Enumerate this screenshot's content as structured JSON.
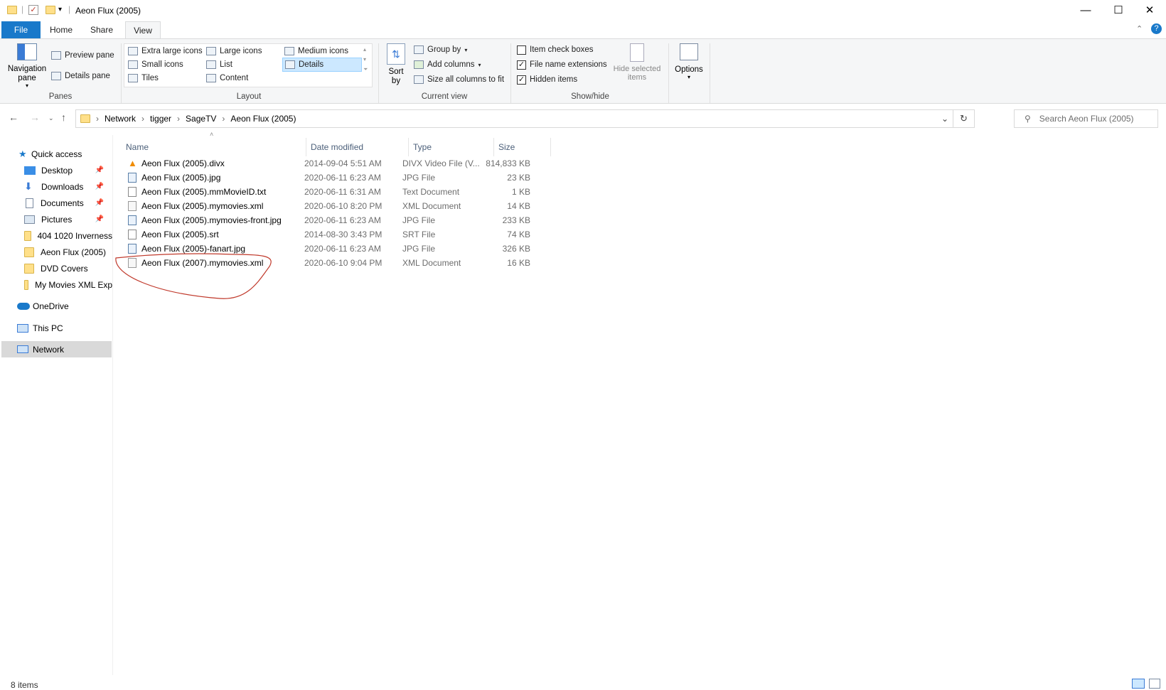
{
  "window": {
    "title": "Aeon Flux (2005)",
    "minimize": "—",
    "maximize": "☐",
    "close": "✕"
  },
  "ribbon_tabs": [
    "File",
    "Home",
    "Share",
    "View"
  ],
  "ribbon": {
    "panes": {
      "navigation_pane": "Navigation pane",
      "preview_pane": "Preview pane",
      "details_pane": "Details pane",
      "label": "Panes"
    },
    "layout": {
      "options": [
        "Extra large icons",
        "Large icons",
        "Medium icons",
        "Small icons",
        "List",
        "Details",
        "Tiles",
        "Content"
      ],
      "selected": "Details",
      "label": "Layout"
    },
    "current_view": {
      "sort_by": "Sort by",
      "group_by": "Group by",
      "add_columns": "Add columns",
      "size_all_columns": "Size all columns to fit",
      "label": "Current view"
    },
    "show_hide": {
      "item_check_boxes": "Item check boxes",
      "item_check_boxes_checked": false,
      "file_name_extensions": "File name extensions",
      "file_name_extensions_checked": true,
      "hidden_items": "Hidden items",
      "hidden_items_checked": true,
      "hide_selected_items": "Hide selected items",
      "label": "Show/hide"
    },
    "options": "Options"
  },
  "address": {
    "crumbs": [
      "Network",
      "tigger",
      "SageTV",
      "Aeon Flux (2005)"
    ],
    "search_placeholder": "Search Aeon Flux (2005)"
  },
  "sidebar": {
    "quick_access": "Quick access",
    "pinned": [
      "Desktop",
      "Downloads",
      "Documents",
      "Pictures"
    ],
    "recent": [
      "404 1020 Inverness",
      "Aeon Flux (2005)",
      "DVD Covers",
      "My Movies XML Exp"
    ],
    "onedrive": "OneDrive",
    "this_pc": "This PC",
    "network": "Network"
  },
  "columns": [
    "Name",
    "Date modified",
    "Type",
    "Size"
  ],
  "files": [
    {
      "name": "Aeon Flux (2005).divx",
      "date": "2014-09-04 5:51 AM",
      "type": "DIVX Video File (V...",
      "size": "814,833 KB",
      "icon": "vlc-cone-icon"
    },
    {
      "name": "Aeon Flux (2005).jpg",
      "date": "2020-06-11 6:23 AM",
      "type": "JPG File",
      "size": "23 KB",
      "icon": "image-file-icon"
    },
    {
      "name": "Aeon Flux (2005).mmMovieID.txt",
      "date": "2020-06-11 6:31 AM",
      "type": "Text Document",
      "size": "1 KB",
      "icon": "text-file-icon"
    },
    {
      "name": "Aeon Flux (2005).mymovies.xml",
      "date": "2020-06-10 8:20 PM",
      "type": "XML Document",
      "size": "14 KB",
      "icon": "xml-file-icon"
    },
    {
      "name": "Aeon Flux (2005).mymovies-front.jpg",
      "date": "2020-06-11 6:23 AM",
      "type": "JPG File",
      "size": "233 KB",
      "icon": "image-file-icon"
    },
    {
      "name": "Aeon Flux (2005).srt",
      "date": "2014-08-30 3:43 PM",
      "type": "SRT File",
      "size": "74 KB",
      "icon": "blank-file-icon"
    },
    {
      "name": "Aeon Flux (2005)-fanart.jpg",
      "date": "2020-06-11 6:23 AM",
      "type": "JPG File",
      "size": "326 KB",
      "icon": "image-file-icon"
    },
    {
      "name": "Aeon Flux (2007).mymovies.xml",
      "date": "2020-06-10 9:04 PM",
      "type": "XML Document",
      "size": "16 KB",
      "icon": "xml-file-icon"
    }
  ],
  "status": {
    "item_count": "8 items"
  },
  "colors": {
    "file_tab": "#1979ca",
    "selected_nav": "#d9d9d9",
    "annotation": "#c0392b"
  }
}
